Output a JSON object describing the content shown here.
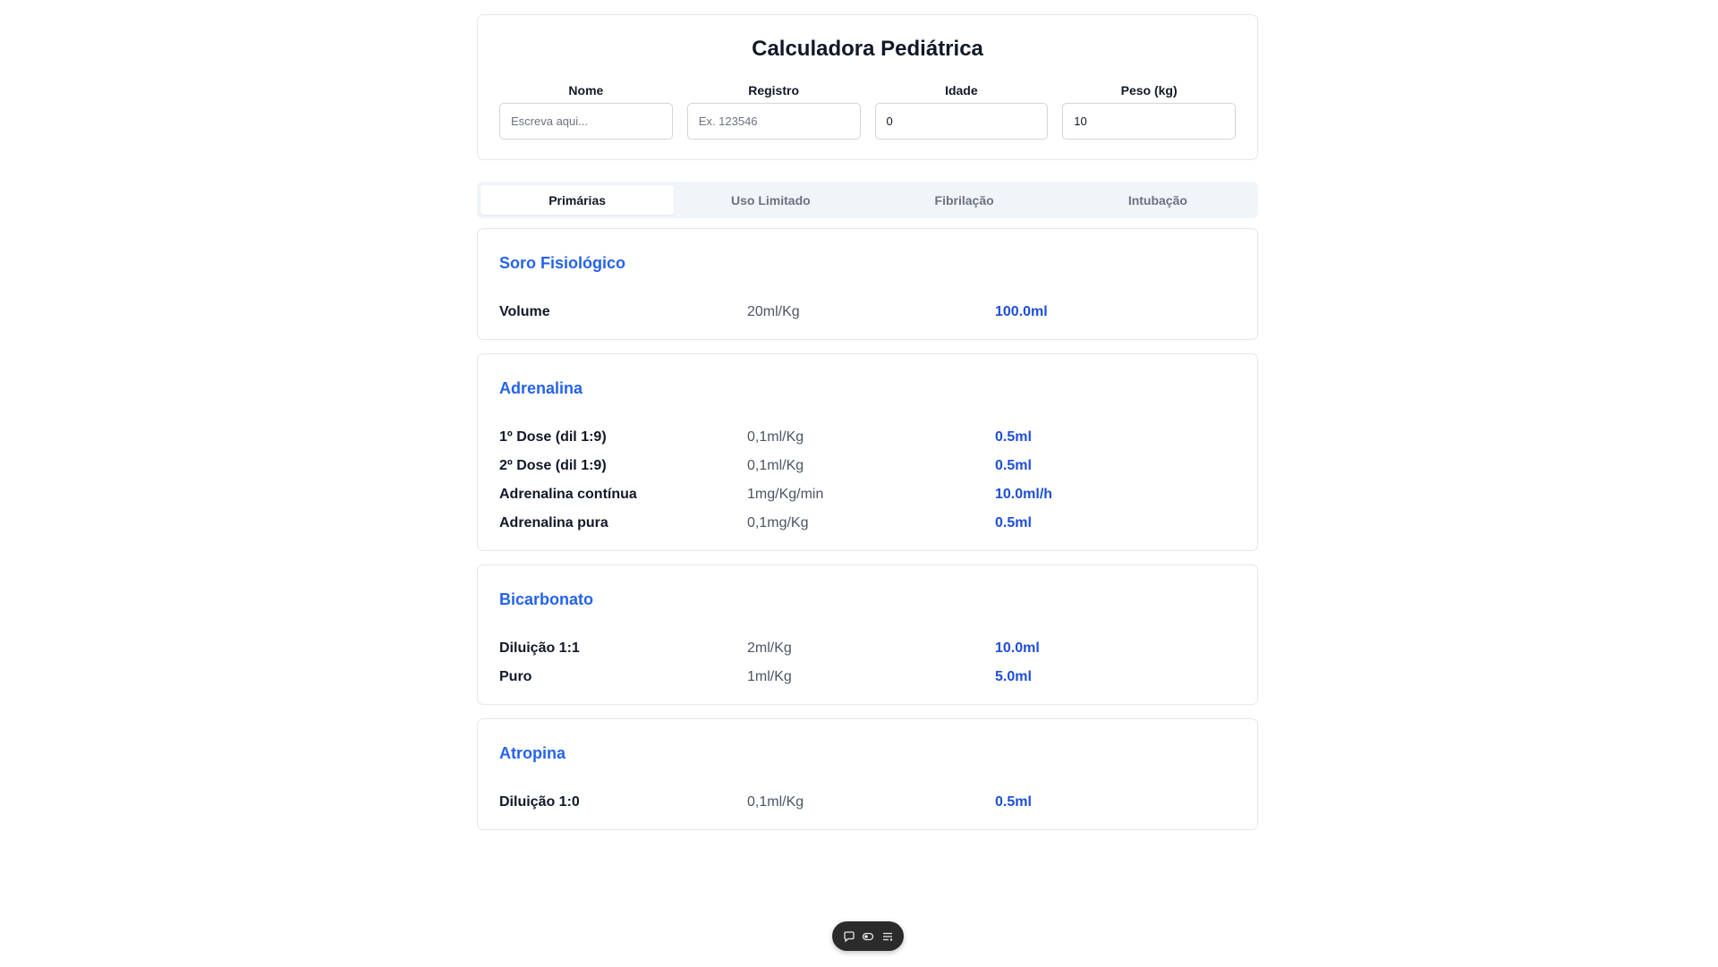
{
  "header": {
    "title": "Calculadora Pediátrica",
    "fields": [
      {
        "label": "Nome",
        "value": "",
        "placeholder": "Escreva aqui..."
      },
      {
        "label": "Registro",
        "value": "",
        "placeholder": "Ex. 123546"
      },
      {
        "label": "Idade",
        "value": "0",
        "placeholder": ""
      },
      {
        "label": "Peso (kg)",
        "value": "10",
        "placeholder": ""
      }
    ]
  },
  "tabs": [
    {
      "label": "Primárias",
      "active": true
    },
    {
      "label": "Uso Limitado",
      "active": false
    },
    {
      "label": "Fibrilação",
      "active": false
    },
    {
      "label": "Intubação",
      "active": false
    }
  ],
  "drugs": [
    {
      "title": "Soro Fisiológico",
      "rows": [
        {
          "name": "Volume",
          "rate": "20ml/Kg",
          "result": "100.0ml"
        }
      ]
    },
    {
      "title": "Adrenalina",
      "rows": [
        {
          "name": "1º Dose (dil 1:9)",
          "rate": "0,1ml/Kg",
          "result": "0.5ml"
        },
        {
          "name": "2º Dose (dil 1:9)",
          "rate": "0,1ml/Kg",
          "result": "0.5ml"
        },
        {
          "name": "Adrenalina contínua",
          "rate": "1mg/Kg/min",
          "result": "10.0ml/h"
        },
        {
          "name": "Adrenalina pura",
          "rate": "0,1mg/Kg",
          "result": "0.5ml"
        }
      ]
    },
    {
      "title": "Bicarbonato",
      "rows": [
        {
          "name": "Diluição 1:1",
          "rate": "2ml/Kg",
          "result": "10.0ml"
        },
        {
          "name": "Puro",
          "rate": "1ml/Kg",
          "result": "5.0ml"
        }
      ]
    },
    {
      "title": "Atropina",
      "rows": [
        {
          "name": "Diluição 1:0",
          "rate": "0,1ml/Kg",
          "result": "0.5ml"
        }
      ]
    }
  ],
  "toolbar": {
    "icons": [
      "chat-icon",
      "toggle-icon",
      "menu-icon"
    ]
  },
  "colors": {
    "accent": "#2563eb",
    "result": "#1d4ed8",
    "tab_bg": "#f1f5f9",
    "border": "#e5e7eb"
  }
}
